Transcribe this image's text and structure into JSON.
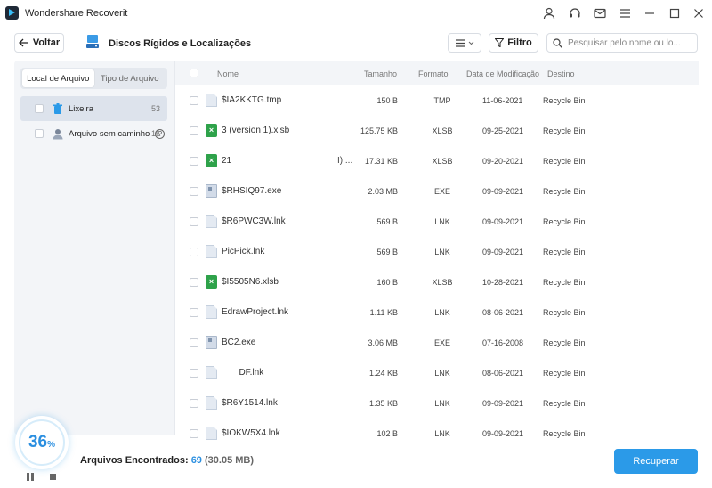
{
  "app": {
    "title": "Wondershare Recoverit"
  },
  "toolbar": {
    "back_label": "Voltar",
    "location_title": "Discos Rígidos e Localizações",
    "filter_label": "Filtro",
    "search_placeholder": "Pesquisar pelo nome ou lo..."
  },
  "sidebar": {
    "tabs": [
      "Local de Arquivo",
      "Tipo de Arquivo"
    ],
    "active_tab": "Local de Arquivo",
    "items": [
      {
        "label": "Lixeira",
        "count": "53",
        "icon": "trash-icon"
      },
      {
        "label": "Arquivo sem caminho",
        "count": "16",
        "icon": "user-file-icon"
      }
    ]
  },
  "table": {
    "columns": [
      "Nome",
      "Tamanho",
      "Formato",
      "Data de Modificação",
      "Destino"
    ],
    "rows": [
      {
        "name": "$IA2KKTG.tmp",
        "size": "150 B",
        "format": "TMP",
        "date": "11-06-2021",
        "dest": "Recycle Bin",
        "icon": "doc"
      },
      {
        "name": "3 (version 1).xlsb",
        "size": "125.75 KB",
        "format": "XLSB",
        "date": "09-25-2021",
        "dest": "Recycle Bin",
        "icon": "xls"
      },
      {
        "name": "21",
        "extra": "I),...",
        "size": "17.31 KB",
        "format": "XLSB",
        "date": "09-20-2021",
        "dest": "Recycle Bin",
        "icon": "xls"
      },
      {
        "name": "$RHSIQ97.exe",
        "size": "2.03 MB",
        "format": "EXE",
        "date": "09-09-2021",
        "dest": "Recycle Bin",
        "icon": "exe"
      },
      {
        "name": "$R6PWC3W.lnk",
        "size": "569 B",
        "format": "LNK",
        "date": "09-09-2021",
        "dest": "Recycle Bin",
        "icon": "doc"
      },
      {
        "name": "PicPick.lnk",
        "size": "569 B",
        "format": "LNK",
        "date": "09-09-2021",
        "dest": "Recycle Bin",
        "icon": "doc"
      },
      {
        "name": "$I5505N6.xlsb",
        "size": "160 B",
        "format": "XLSB",
        "date": "10-28-2021",
        "dest": "Recycle Bin",
        "icon": "xls"
      },
      {
        "name": "EdrawProject.lnk",
        "size": "1.11 KB",
        "format": "LNK",
        "date": "08-06-2021",
        "dest": "Recycle Bin",
        "icon": "doc"
      },
      {
        "name": "BC2.exe",
        "size": "3.06 MB",
        "format": "EXE",
        "date": "07-16-2008",
        "dest": "Recycle Bin",
        "icon": "exe"
      },
      {
        "name": "       DF.lnk",
        "size": "1.24 KB",
        "format": "LNK",
        "date": "08-06-2021",
        "dest": "Recycle Bin",
        "icon": "doc"
      },
      {
        "name": "$R6Y1514.lnk",
        "size": "1.35 KB",
        "format": "LNK",
        "date": "09-09-2021",
        "dest": "Recycle Bin",
        "icon": "doc"
      },
      {
        "name": "$IOKW5X4.lnk",
        "size": "102 B",
        "format": "LNK",
        "date": "09-09-2021",
        "dest": "Recycle Bin",
        "icon": "doc"
      }
    ]
  },
  "footer": {
    "progress_percent": "36",
    "progress_unit": "%",
    "found_label": "Arquivos Encontrados:",
    "found_count": "69",
    "found_size": "(30.05 MB)",
    "recover_label": "Recuperar"
  },
  "colors": {
    "accent": "#2b9ae8",
    "excel": "#2ea24a"
  }
}
